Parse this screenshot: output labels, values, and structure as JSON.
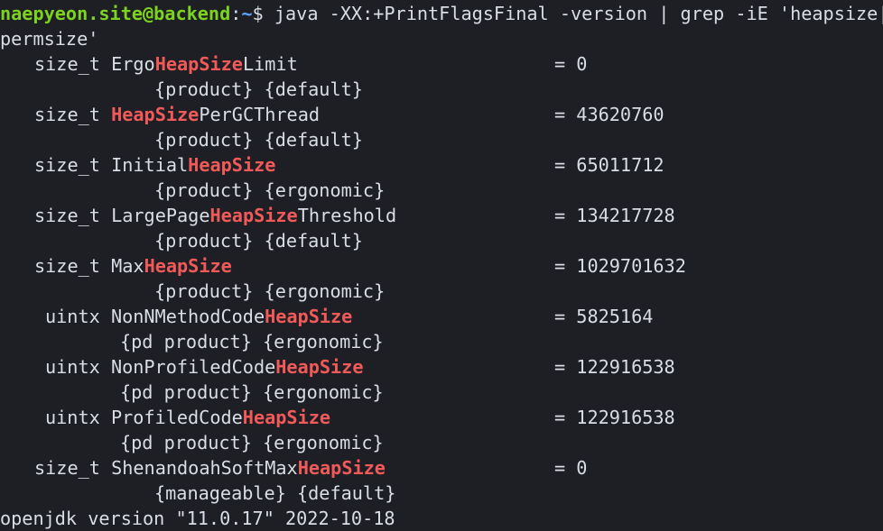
{
  "prompt": {
    "user_host": "naepyeon.site@backend",
    "separator": ":",
    "path": "~",
    "symbol": "$",
    "command": " java -XX:+PrintFlagsFinal -version | grep -iE 'heapsize|",
    "command_wrap": "permsize'"
  },
  "highlight_color": "#f25a5a",
  "flags": [
    {
      "type": "size_t",
      "pre": "Ergo",
      "hl": "HeapSize",
      "post": "Limit",
      "value": "= 0",
      "attrs": "{product} {default}"
    },
    {
      "type": "size_t",
      "pre": "",
      "hl": "HeapSize",
      "post": "PerGCThread",
      "value": "= 43620760",
      "attrs": "{product} {default}"
    },
    {
      "type": "size_t",
      "pre": "Initial",
      "hl": "HeapSize",
      "post": "",
      "value": "= 65011712",
      "attrs": "{product} {ergonomic}"
    },
    {
      "type": "size_t",
      "pre": "LargePage",
      "hl": "HeapSize",
      "post": "Threshold",
      "value": "= 134217728",
      "attrs": "{product} {default}"
    },
    {
      "type": "size_t",
      "pre": "Max",
      "hl": "HeapSize",
      "post": "",
      "value": "= 1029701632",
      "attrs": "{product} {ergonomic}"
    },
    {
      "type": "uintx",
      "pre": "NonNMethodCode",
      "hl": "HeapSize",
      "post": "",
      "value": "= 5825164",
      "attrs": "{pd product} {ergonomic}"
    },
    {
      "type": "uintx",
      "pre": "NonProfiledCode",
      "hl": "HeapSize",
      "post": "",
      "value": "= 122916538",
      "attrs": "{pd product} {ergonomic}"
    },
    {
      "type": "uintx",
      "pre": "ProfiledCode",
      "hl": "HeapSize",
      "post": "",
      "value": "= 122916538",
      "attrs": "{pd product} {ergonomic}"
    },
    {
      "type": "size_t",
      "pre": "ShenandoahSoftMax",
      "hl": "HeapSize",
      "post": "",
      "value": "= 0",
      "attrs": "{manageable} {default}"
    }
  ],
  "footer": "openjdk version \"11.0.17\" 2022-10-18"
}
